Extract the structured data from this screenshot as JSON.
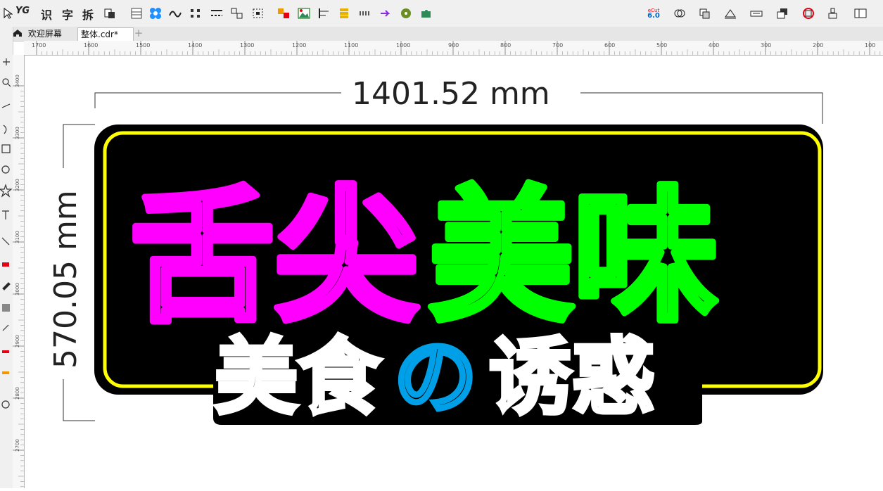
{
  "toolbar": {
    "text_buttons": [
      "YG",
      "识",
      "字",
      "拆"
    ],
    "ecut_label": "eCut",
    "ecut_version": "6.0"
  },
  "tabs": [
    {
      "label": "欢迎屏幕"
    },
    {
      "label": "整体.cdr*"
    }
  ],
  "ruler_top": [
    "1700",
    "1600",
    "1500",
    "1400",
    "1300",
    "1200",
    "1100",
    "1000",
    "900",
    "800",
    "700",
    "600",
    "500",
    "400",
    "300",
    "200",
    "100"
  ],
  "ruler_left": [
    "3400",
    "3300",
    "3200",
    "3100",
    "3000",
    "2900",
    "2800",
    "2700"
  ],
  "artwork": {
    "width_dimension": "1401.52 mm",
    "height_dimension": "570.05 mm",
    "title_magenta": "舌尖",
    "title_green": "美味",
    "subtitle_white_a": "美食",
    "subtitle_blue": "の",
    "subtitle_white_b": "诱惑"
  },
  "colors": {
    "magenta": "#ff00ff",
    "green": "#00ff00",
    "yellow": "#ffff00",
    "blue": "#00a0e9",
    "white": "#ffffff",
    "black": "#000000"
  }
}
